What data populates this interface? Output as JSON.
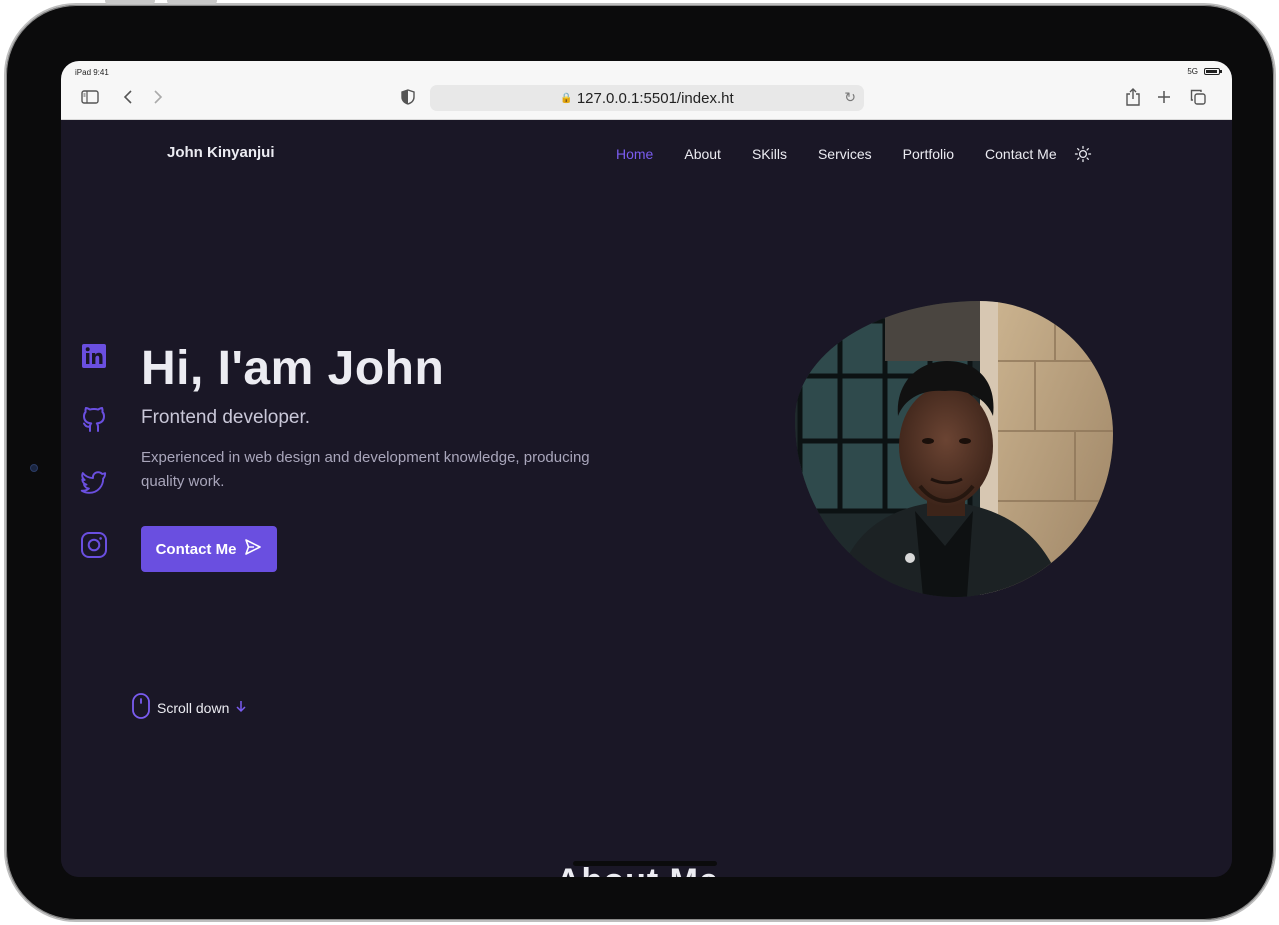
{
  "status": {
    "time": "iPad 9:41",
    "network": "5G"
  },
  "browser": {
    "url": "127.0.0.1:5501/index.ht"
  },
  "site": {
    "logo": "John Kinyanjui",
    "nav": [
      "Home",
      "About",
      "SKills",
      "Services",
      "Portfolio",
      "Contact Me"
    ],
    "active_nav": "Home",
    "hero": {
      "title": "Hi, I'am John",
      "subtitle": "Frontend developer.",
      "description": "Experienced in web design and development knowledge, producing quality work.",
      "cta": "Contact Me"
    },
    "scroll": "Scroll down",
    "next_section_heading_peek": "About Me"
  },
  "colors": {
    "accent": "#6a4fe0",
    "active_nav": "#7a5cf0",
    "background": "#1a1726"
  }
}
